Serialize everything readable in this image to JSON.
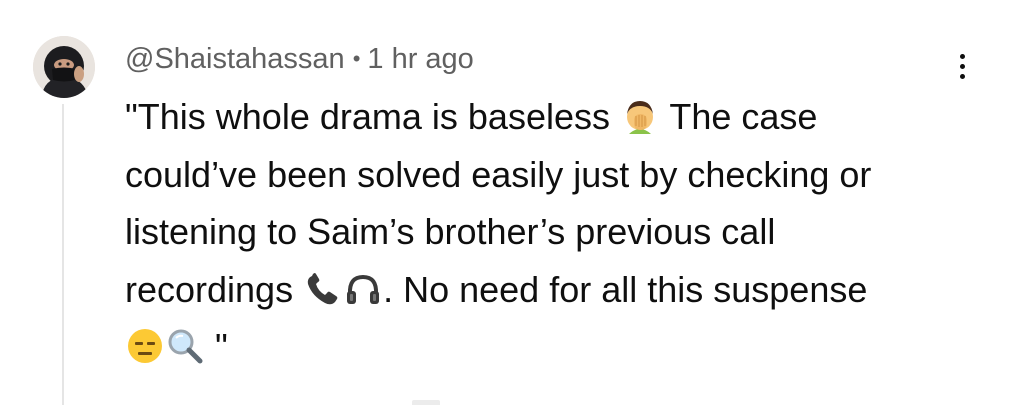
{
  "comment": {
    "author": "@Shaistahassan",
    "separator": "•",
    "timestamp": "1 hr ago",
    "avatar_icon": "user-avatar-icon",
    "more_icon": "more-vertical-icon",
    "text_segments": {
      "line1_a": "\"This whole drama is baseless ",
      "line1_b": " The case",
      "line2": "could’ve been solved easily just by checking or",
      "line3": "listening to Saim’s brother’s previous call",
      "line4_a": "recordings ",
      "line4_b": ". No need for all this suspense",
      "line5_b": " \""
    },
    "emojis": [
      "man-facepalming-emoji",
      "telephone-receiver-emoji",
      "headphone-emoji",
      "expressionless-face-emoji",
      "magnifying-glass-emoji"
    ]
  },
  "colors": {
    "text_primary": "#0f0f0f",
    "text_secondary": "#606060",
    "thread_line": "#e5e5e5"
  }
}
